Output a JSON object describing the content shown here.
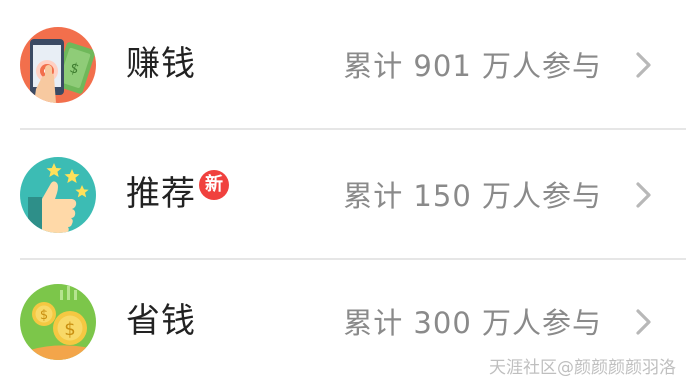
{
  "items": [
    {
      "label": "赚钱",
      "stat": "累计 901 万人参与",
      "icon": "tap-phone-money-icon",
      "badge": ""
    },
    {
      "label": "推荐",
      "stat": "累计 150 万人参与",
      "icon": "thumbs-up-stars-icon",
      "badge": "新"
    },
    {
      "label": "省钱",
      "stat": "累计 300 万人参与",
      "icon": "coins-dollar-icon",
      "badge": ""
    }
  ],
  "watermark": "天涯社区@颜颜颜颜羽洛",
  "colors": {
    "text": "#222222",
    "stat_text": "#8a8a8a",
    "badge": "#f0413e",
    "divider": "#e6e6e6",
    "chevron": "#b8b8b8"
  }
}
